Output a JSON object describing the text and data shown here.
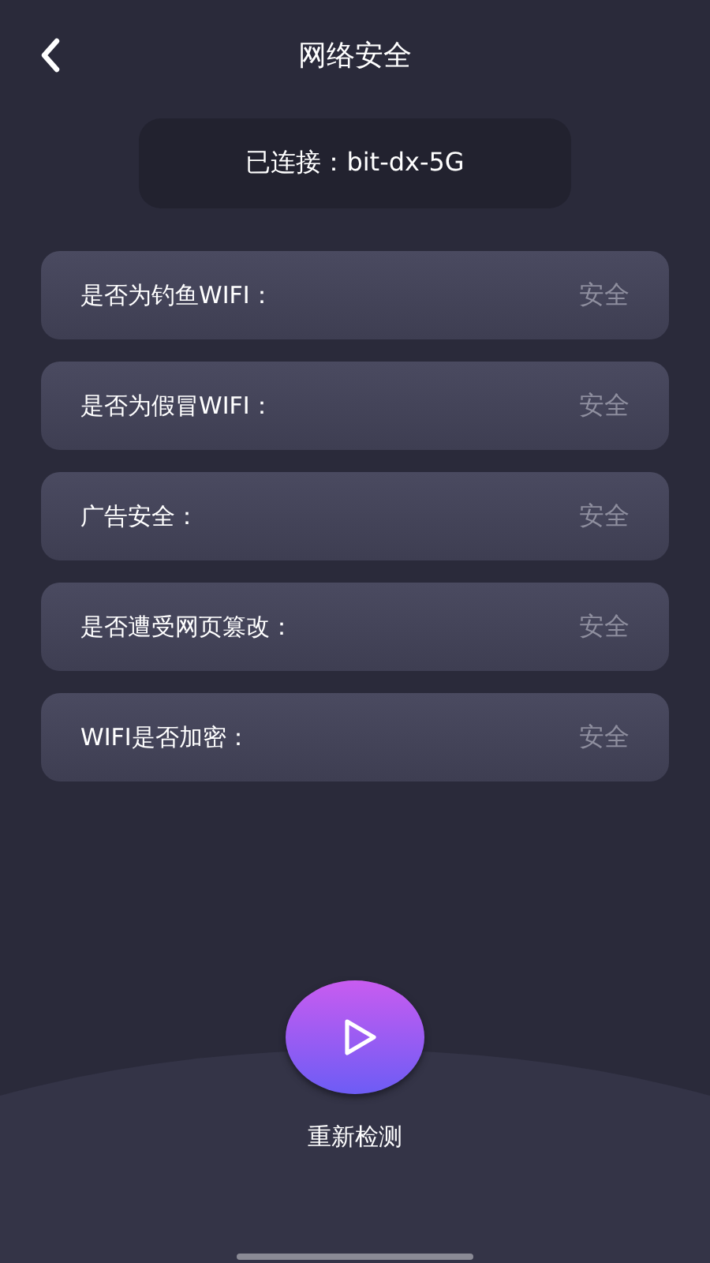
{
  "header": {
    "title": "网络安全"
  },
  "connection": {
    "text": "已连接：bit-dx-5G"
  },
  "checks": [
    {
      "label": "是否为钓鱼WIFI：",
      "result": "安全"
    },
    {
      "label": "是否为假冒WIFI：",
      "result": "安全"
    },
    {
      "label": "广告安全：",
      "result": "安全"
    },
    {
      "label": "是否遭受网页篡改：",
      "result": "安全"
    },
    {
      "label": "WIFI是否加密：",
      "result": "安全"
    }
  ],
  "action": {
    "label": "重新检测"
  }
}
